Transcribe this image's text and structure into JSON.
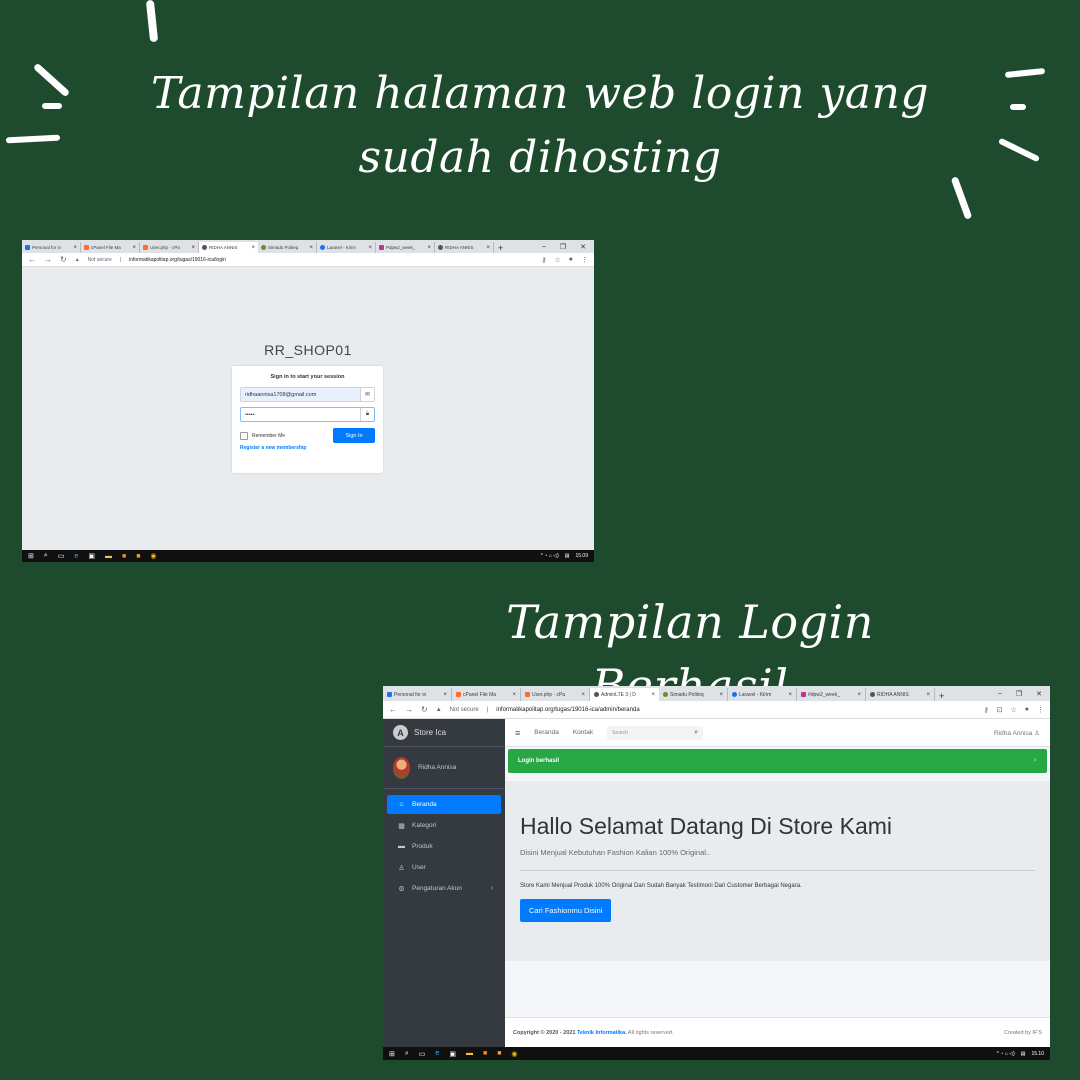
{
  "headline_top": "Tampilan halaman web login yang sudah dihosting",
  "headline_bottom": "Tampilan Login Berhasil",
  "colors": {
    "background": "#1e4a2e",
    "primary": "#007bff",
    "success": "#28a745",
    "sidebar": "#343a40"
  },
  "login_shot": {
    "tabs": [
      "Personal for in",
      "cPanel File Ma",
      "User.php - cPa",
      "RIDHA ANNIS",
      "Simadu Politeq",
      "Laravel - Kirim",
      "Pdpw2_week_",
      "RIDHA ANNIS"
    ],
    "url_security": "Not secure",
    "url": "informatikapolitap.org/tugas/19016-ica/login",
    "logo": "RR_SHOP01",
    "login_message": "Sign in to start your session",
    "email_value": "ridhaannisa1708@gmail.com",
    "password_value": "•••••",
    "remember_label": "Remember Me",
    "signin_label": "Sign In",
    "register_link": "Register a new membership",
    "clock": "15.09"
  },
  "admin_shot": {
    "tabs": [
      "Personal for in",
      "cPanel File Ma",
      "User.php - cPa",
      "AdminLTE 3 | D",
      "Simadu Politeq",
      "Laravel - Kirim",
      "#dpw2_week_",
      "RIDHA ANNIS"
    ],
    "url_security": "Not secure",
    "url": "informatikapolitap.org/tugas/19016-ica/admin/beranda",
    "brand": "Store Ica",
    "brand_icon": "store-logo",
    "user": "Ridha Annisa",
    "sidebar": [
      {
        "label": "Beranda",
        "icon": "home-icon"
      },
      {
        "label": "Kategori",
        "icon": "grid-icon"
      },
      {
        "label": "Produk",
        "icon": "box-icon"
      },
      {
        "label": "User",
        "icon": "user-icon"
      },
      {
        "label": "Pengaturan Akun",
        "icon": "gear-icon"
      }
    ],
    "topnav": {
      "home": "Beranda",
      "contact": "Kontak",
      "search_placeholder": "Search",
      "user": "Ridha Annisa"
    },
    "alert": "Login berhasil",
    "heading": "Hallo Selamat Datang Di Store Kami",
    "lead": "Disini Menjual Kebutuhan Fashion Kalian 100% Original..",
    "description": "Store Kami Menjual Produk 100% Original Dan Sudah Banyak Testimoni Dari Customer Berbagai Negara.",
    "cta": "Cari Fashionmu Disini",
    "footer": {
      "copyright": "Copyright © 2020 - 2021",
      "org": "Teknik Informatika.",
      "rights": "All rights reserved.",
      "credit": "Created by IF'S"
    },
    "clock": "15.10"
  }
}
